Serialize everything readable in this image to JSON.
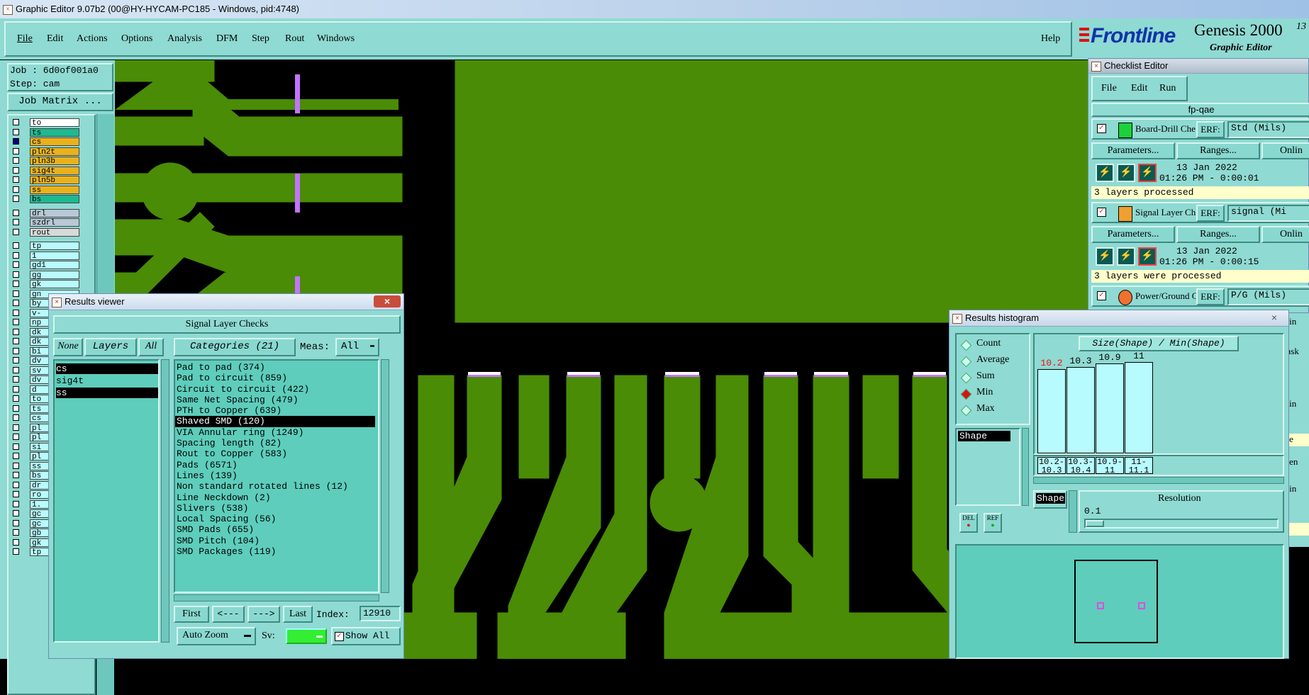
{
  "window": {
    "title": "Graphic Editor 9.07b2 (00@HY-HYCAM-PC185 - Windows, pid:4748)"
  },
  "menu": {
    "items": [
      "File",
      "Edit",
      "Actions",
      "Options",
      "Analysis",
      "DFM",
      "Step",
      "Rout",
      "Windows"
    ],
    "help": "Help"
  },
  "brand": {
    "logo": "Frontline",
    "product": "Genesis 2000",
    "subtitle": "Graphic Editor",
    "version_corner": "13"
  },
  "job": {
    "job": "Job : 6d0of001a0",
    "step": "Step: cam",
    "matrix_button": "Job Matrix ..."
  },
  "layers": {
    "group1": [
      {
        "name": "to",
        "color": "#ffffff"
      },
      {
        "name": "ts",
        "color": "#1eb98f"
      },
      {
        "name": "cs",
        "color": "#e9b21c"
      },
      {
        "name": "pln2t",
        "color": "#e9b21c"
      },
      {
        "name": "pln3b",
        "color": "#e9b21c"
      },
      {
        "name": "sig4t",
        "color": "#e9b21c"
      },
      {
        "name": "pln5b",
        "color": "#e9b21c"
      },
      {
        "name": "ss",
        "color": "#e9b21c"
      },
      {
        "name": "bs",
        "color": "#1eb98f"
      }
    ],
    "group2": [
      {
        "name": "drl",
        "color": "#b9c7d6"
      },
      {
        "name": "szdrl",
        "color": "#b9c7d6"
      },
      {
        "name": "rout",
        "color": "#d9d9d9"
      }
    ],
    "group3": [
      "tp",
      "1",
      "gd1",
      "gg",
      "gk",
      "gn",
      "by",
      "v-",
      "np",
      "dk",
      "dk",
      "bi",
      "dv",
      "sv",
      "dv",
      "d",
      "to",
      "ts",
      "cs",
      "pl",
      "pl",
      "si",
      "pl",
      "ss",
      "bs",
      "dr",
      "ro",
      "1.",
      "gc",
      "gc",
      "gb",
      "gk",
      "tp"
    ]
  },
  "results_viewer": {
    "title": "Results viewer",
    "header": "Signal Layer Checks",
    "none_btn": "None",
    "layers_btn": "Layers",
    "all_btn": "All",
    "categories_btn": "Categories (21)",
    "meas_label": "Meas:",
    "meas_value": "All",
    "layers": [
      "cs",
      "sig4t",
      "ss"
    ],
    "categories": [
      "Pad to pad (374)",
      "Pad to circuit (859)",
      "Circuit to circuit (422)",
      "Same Net Spacing (479)",
      "PTH to Copper (639)",
      "Shaved SMD (120)",
      "VIA Annular ring (1249)",
      "Spacing length (82)",
      "Rout to Copper (583)",
      "Pads (6571)",
      "Lines (139)",
      "Non standard rotated lines (12)",
      "Line Neckdown (2)",
      "Slivers (538)",
      "Local Spacing (56)",
      "SMD Pads (655)",
      "SMD Pitch (104)",
      "SMD Packages (119)"
    ],
    "nav": {
      "first": "First",
      "prev": "<---",
      "next": "--->",
      "last": "Last",
      "index_label": "Index:",
      "index_value": "12910"
    },
    "zoom": "Auto Zoom",
    "sv_label": "Sv:",
    "show_all": "Show All"
  },
  "checklist": {
    "title": "Checklist Editor",
    "menu": [
      "File",
      "Edit",
      "Run"
    ],
    "name": "fp-qae",
    "checks": [
      {
        "name": "Board-Drill Che",
        "erf": "ERF:",
        "erf_value": "Std (Mils)",
        "params": "Parameters...",
        "ranges": "Ranges...",
        "online": "Onlin",
        "date": "13 Jan 2022",
        "time": "01:26 PM - 0:00:01",
        "status": "3 layers processed"
      },
      {
        "name": "Signal Layer Ch",
        "erf": "ERF:",
        "erf_value": "signal (Mi",
        "params": "Parameters...",
        "ranges": "Ranges...",
        "online": "Onlin",
        "date": "13 Jan 2022",
        "time": "01:26 PM - 0:00:15",
        "status": "3 layers were processed"
      },
      {
        "name": "Power/Ground C",
        "erf": "ERF:",
        "erf_value": "P/G (Mils)"
      }
    ],
    "side_fragments": [
      "nlin",
      "nask",
      "nlin",
      "sse",
      "reen",
      "nlin"
    ]
  },
  "histogram": {
    "title": "Results histogram",
    "modes": [
      "Count",
      "Average",
      "Sum",
      "Min",
      "Max"
    ],
    "selected_mode": "Min",
    "chart_title": "Size(Shape) / Min(Shape)",
    "values": [
      "10.2",
      "10.3",
      "10.9",
      "11"
    ],
    "levels": [
      0.85,
      0.87,
      0.91,
      0.92
    ],
    "ranges": [
      [
        "10.2-",
        "10.3"
      ],
      [
        "10.3-",
        "10.4"
      ],
      [
        "10.9-",
        "11"
      ],
      [
        "11-",
        "11.1"
      ]
    ],
    "shape_label": "Shape",
    "shape_btn": "Shape",
    "resolution_label": "Resolution",
    "resolution_value": "0.1",
    "del_btn": "DEL",
    "ref_btn": "REF"
  }
}
